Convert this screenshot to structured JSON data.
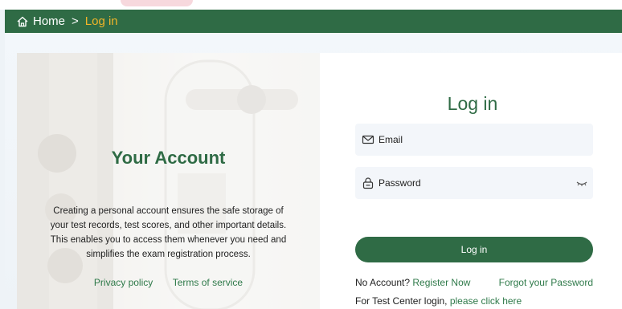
{
  "breadcrumb": {
    "home_label": "Home",
    "separator": ">",
    "current": "Log in",
    "home_icon": "home-icon"
  },
  "left": {
    "title": "Your Account",
    "description_lines": [
      "Creating a personal account ensures the safe storage of",
      "your test records, test scores, and other important details.",
      "This enables you to access them whenever you need and",
      "simplifies the exam registration process."
    ],
    "privacy_link": "Privacy policy",
    "terms_link": "Terms of service"
  },
  "login": {
    "title": "Log in",
    "email_placeholder": "Email",
    "email_icon": "mail-icon",
    "password_placeholder": "Password",
    "password_icon": "lock-icon",
    "eye_icon": "eye-closed-icon",
    "button_label": "Log in",
    "no_account_text": "No Account?",
    "register_link": "Register Now",
    "forgot_link": "Forgot your Password",
    "test_center_text": "For Test Center login,",
    "test_center_link": "please click here"
  },
  "colors": {
    "brand_green": "#2f6b45",
    "link_green": "#2f7a4a",
    "breadcrumb_current": "#f0b429",
    "field_bg": "#f3f6fa"
  }
}
